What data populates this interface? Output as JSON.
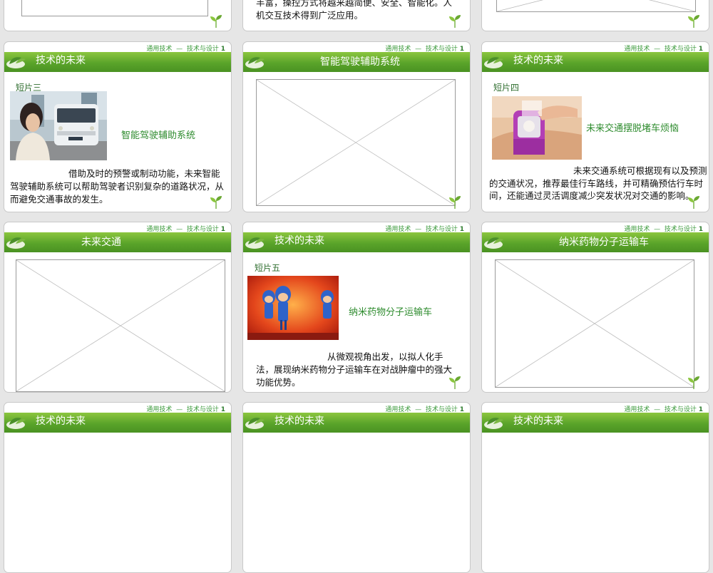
{
  "breadcrumb": {
    "left": "通用技术",
    "right": "技术与设计",
    "num": "1"
  },
  "slides": {
    "top_middle": {
      "text": "丰富，操控方式将越来越简便、安全、智能化。人机交互技术得到广泛应用。"
    },
    "r2c1": {
      "header": "技术的未来",
      "clip_label": "短片三",
      "clip_title": "智能驾驶辅助系统",
      "text": "借助及时的预警或制动功能，未来智能驾驶辅助系统可以帮助驾驶者识别复杂的道路状况，从而避免交通事故的发生。"
    },
    "r2c2": {
      "header": "智能驾驶辅助系统"
    },
    "r2c3": {
      "header": "技术的未来",
      "clip_label": "短片四",
      "clip_title": "未来交通摆脱堵车烦恼",
      "text": "未来交通系统可根据现有以及预测的交通状况，推荐最佳行车路线，并可精确预估行车时间，还能通过灵活调度减少突发状况对交通的影响。"
    },
    "r3c1": {
      "header": "未来交通"
    },
    "r3c2": {
      "header": "技术的未来",
      "clip_label": "短片五",
      "clip_title": "纳米药物分子运输车",
      "text": "从微观视角出发，以拟人化手法，展现纳米药物分子运输车在对战肿瘤中的强大功能优势。"
    },
    "r3c3": {
      "header": "纳米药物分子运输车"
    },
    "r4c1": {
      "header": "技术的未来"
    },
    "r4c2": {
      "header": "技术的未来"
    },
    "r4c3": {
      "header": "技术的未来"
    }
  }
}
